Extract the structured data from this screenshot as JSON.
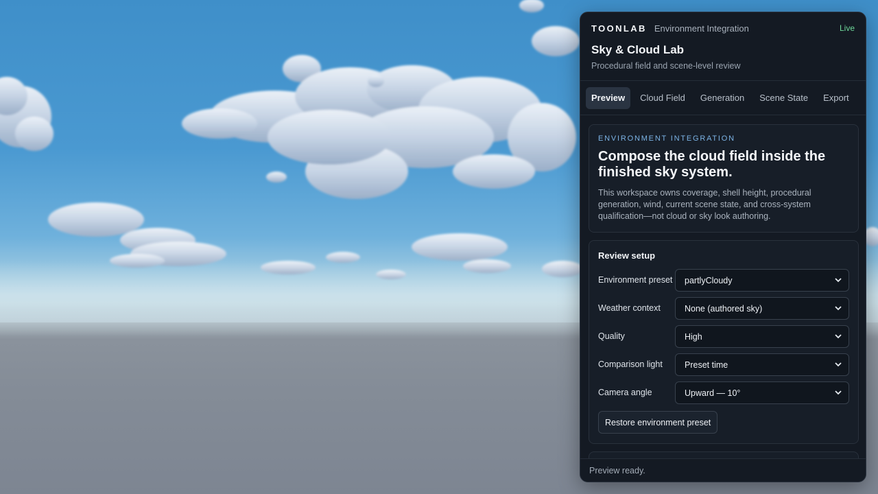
{
  "panel": {
    "brand": "TOONLAB",
    "context": "Environment Integration",
    "status": "Live",
    "title": "Sky & Cloud Lab",
    "subtitle": "Procedural field and scene-level review"
  },
  "tabs": [
    {
      "label": "Preview",
      "active": true
    },
    {
      "label": "Cloud Field",
      "active": false
    },
    {
      "label": "Generation",
      "active": false
    },
    {
      "label": "Scene State",
      "active": false
    },
    {
      "label": "Export",
      "active": false
    }
  ],
  "intro": {
    "eyebrow": "ENVIRONMENT INTEGRATION",
    "headline": "Compose the cloud field inside the finished sky system.",
    "description": "This workspace owns coverage, shell height, procedural generation, wind, current scene state, and cross-system qualification—not cloud or sky look authoring."
  },
  "review_setup": {
    "title": "Review setup",
    "fields": [
      {
        "label": "Environment preset",
        "value": "partlyCloudy"
      },
      {
        "label": "Weather context",
        "value": "None (authored sky)"
      },
      {
        "label": "Quality",
        "value": "High"
      },
      {
        "label": "Comparison light",
        "value": "Preset time"
      },
      {
        "label": "Camera angle",
        "value": "Upward — 10°"
      }
    ],
    "restore_label": "Restore environment preset"
  },
  "footer": {
    "status": "Preview ready."
  },
  "colors": {
    "accent": "#7cb4e6",
    "live": "#6fd99b",
    "panel_bg": "#141a23"
  }
}
